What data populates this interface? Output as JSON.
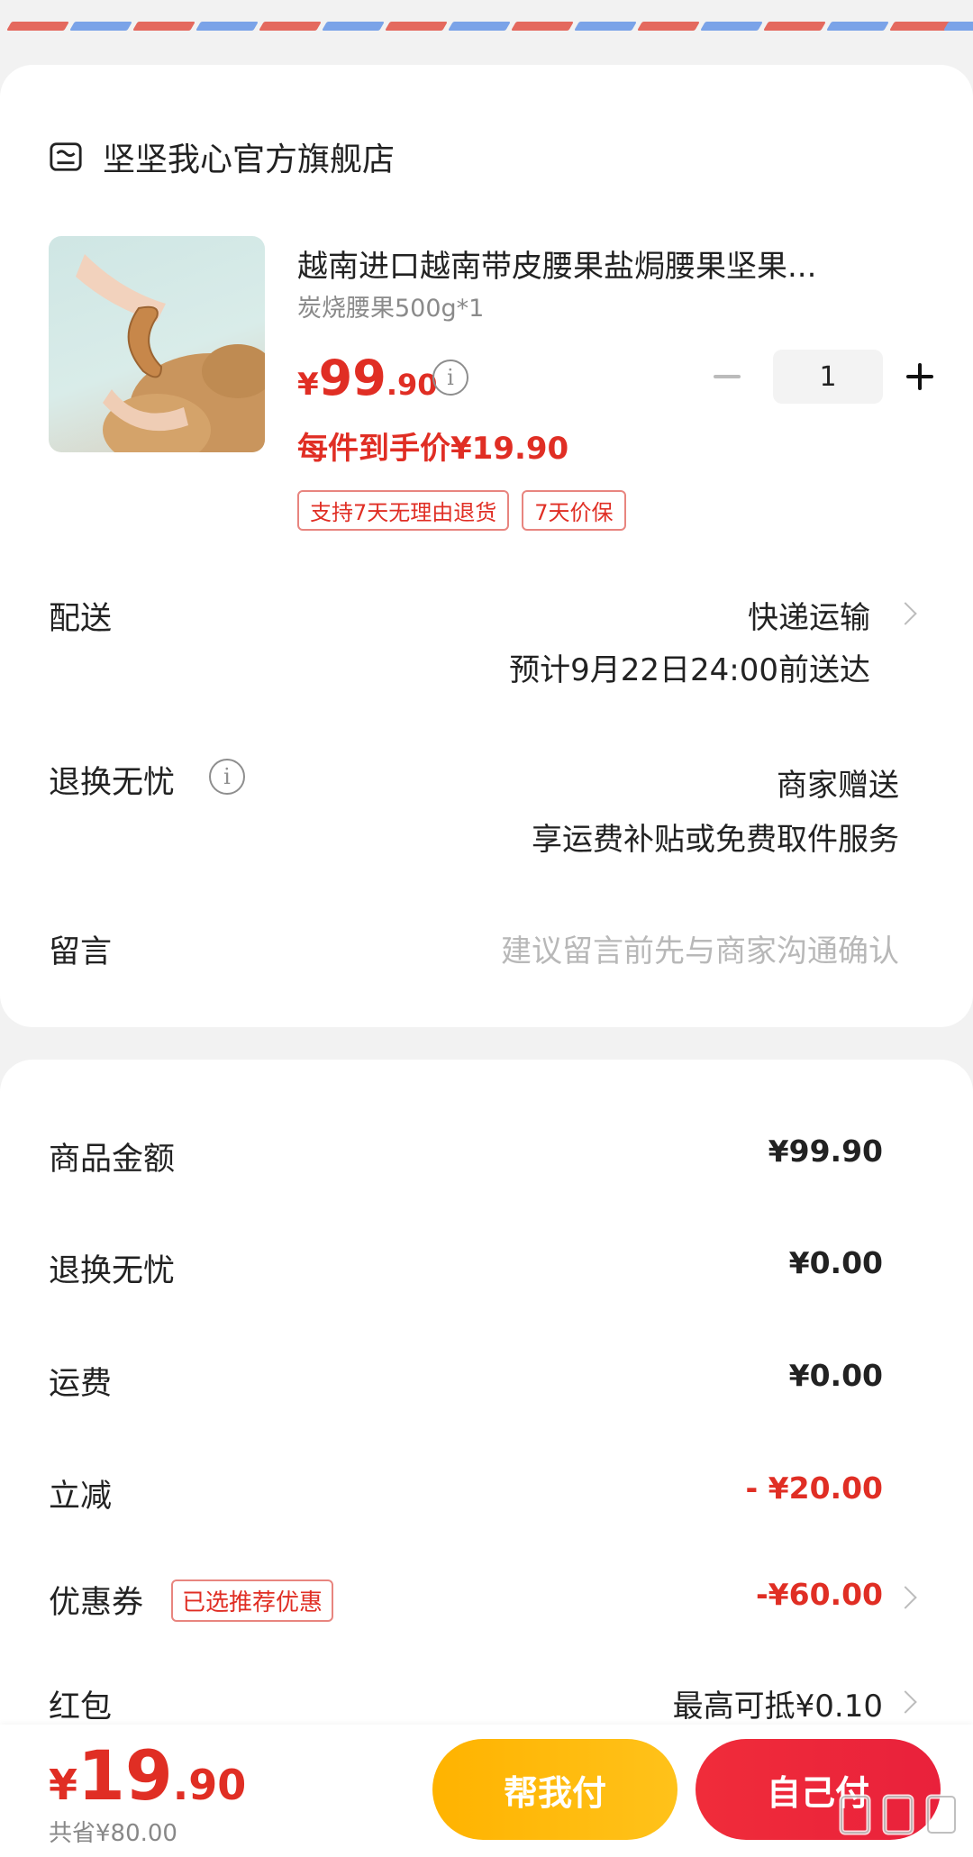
{
  "shop": {
    "name": "坚坚我心官方旗舰店"
  },
  "product": {
    "title": "越南进口越南带皮腰果盐焗腰果坚果...",
    "spec": "炭烧腰果500g*1",
    "price_currency": "¥",
    "price_int": "99",
    "price_dec": ".90",
    "quantity": "1",
    "unit_price_text": "每件到手价¥19.90",
    "tags": [
      "支持7天无理由退货",
      "7天价保"
    ]
  },
  "delivery": {
    "label": "配送",
    "method": "快递运输",
    "eta": "预计9月22日24:00前送达"
  },
  "returns": {
    "label": "退换无忧",
    "value": "商家赠送",
    "desc": "享运费补贴或免费取件服务"
  },
  "message": {
    "label": "留言",
    "placeholder": "建议留言前先与商家沟通确认"
  },
  "summary": {
    "goods_label": "商品金额",
    "goods_value": "¥99.90",
    "returns_label": "退换无忧",
    "returns_value": "¥0.00",
    "shipping_label": "运费",
    "shipping_value": "¥0.00",
    "discount_label": "立减",
    "discount_value": "- ¥20.00",
    "coupon_label": "优惠券",
    "coupon_tag": "已选推荐优惠",
    "coupon_value": "-¥60.00",
    "redpacket_label": "红包",
    "redpacket_value": "最高可抵¥0.10"
  },
  "footer": {
    "total_currency": "¥",
    "total_int": "19",
    "total_dec": ".90",
    "saved_text": "共省¥80.00",
    "help_pay_label": "帮我付",
    "self_pay_label": "自己付"
  },
  "colors": {
    "accent_red": "#e02e24",
    "help_button": "#ffb300",
    "self_button": "#f02c3a",
    "airmail_red": "#e4695e",
    "airmail_blue": "#7aa3e8"
  }
}
